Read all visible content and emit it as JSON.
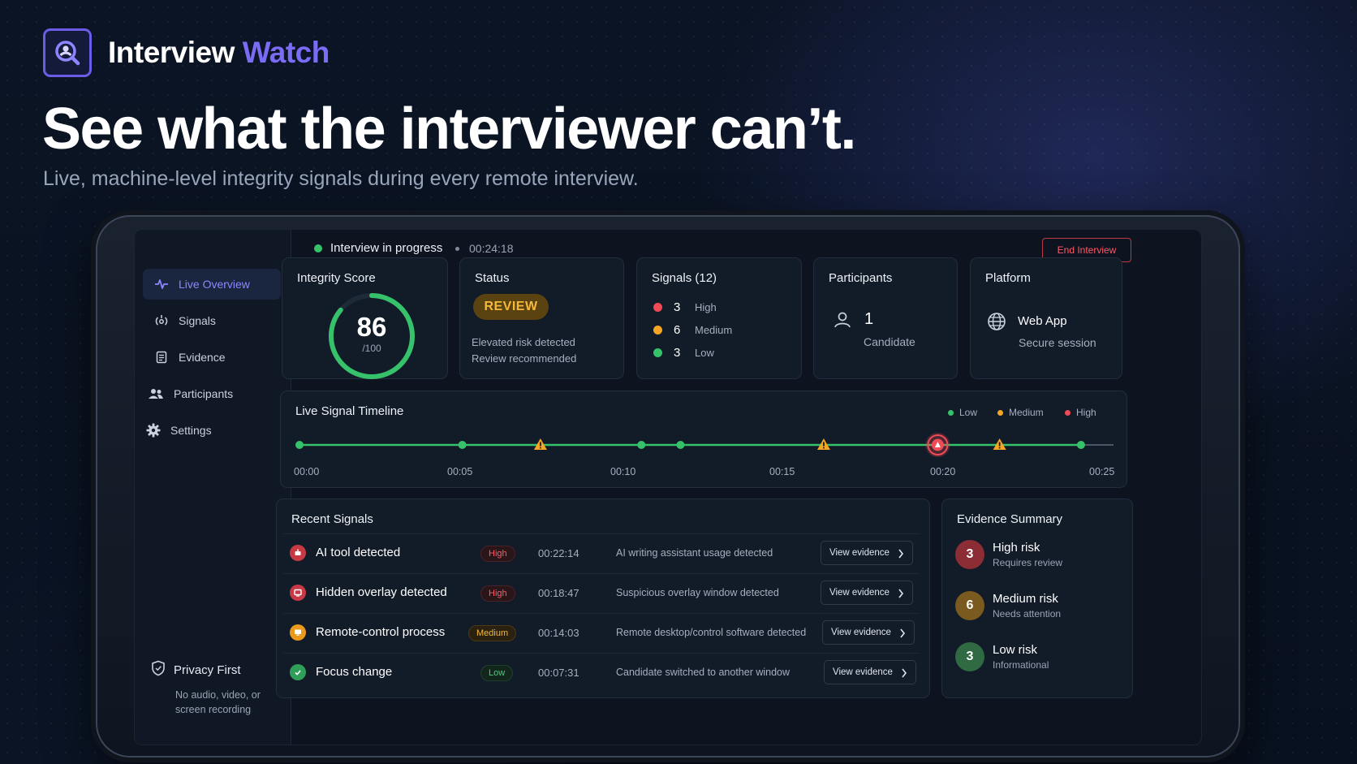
{
  "brand": {
    "name_part1": "Interview",
    "name_part2": "Watch",
    "accent_color": "#7b6cf6"
  },
  "hero": {
    "title": "See what the interviewer can’t.",
    "subtitle": "Live, machine-level integrity signals during every remote interview."
  },
  "sidebar": {
    "items": [
      {
        "label": "Live Overview",
        "icon": "pulse-icon",
        "active": true
      },
      {
        "label": "Signals",
        "icon": "broadcast-icon"
      },
      {
        "label": "Evidence",
        "icon": "document-icon"
      },
      {
        "label": "Participants",
        "icon": "users-icon"
      },
      {
        "label": "Settings",
        "icon": "gear-icon"
      }
    ],
    "privacy": {
      "title": "Privacy First",
      "description": "No audio, video, or screen recording"
    }
  },
  "topbar": {
    "status": "Interview in progress",
    "elapsed": "00:24:18",
    "end_label": "End Interview"
  },
  "integrity": {
    "title": "Integrity Score",
    "score": "86",
    "max": "/100",
    "fraction": 0.86,
    "color": "#36c26a"
  },
  "status": {
    "title": "Status",
    "badge": "REVIEW",
    "line1": "Elevated risk detected",
    "line2": "Review recommended"
  },
  "signals": {
    "title": "Signals (12)",
    "rows": [
      {
        "count": "3",
        "label": "High",
        "color": "#ef4a55"
      },
      {
        "count": "6",
        "label": "Medium",
        "color": "#f5a524"
      },
      {
        "count": "3",
        "label": "Low",
        "color": "#36c26a"
      }
    ]
  },
  "participants": {
    "title": "Participants",
    "count": "1",
    "label": "Candidate"
  },
  "platform": {
    "title": "Platform",
    "name": "Web App",
    "sub": "Secure session"
  },
  "timeline": {
    "title": "Live Signal Timeline",
    "legend": [
      "Low",
      "Medium",
      "High"
    ],
    "ticks": [
      "00:00",
      "00:05",
      "00:10",
      "00:15",
      "00:20",
      "00:25"
    ],
    "events": [
      {
        "t": 0,
        "level": "low"
      },
      {
        "t": 5,
        "level": "low"
      },
      {
        "t": 7.4,
        "level": "medium"
      },
      {
        "t": 10.5,
        "level": "low"
      },
      {
        "t": 11.7,
        "level": "low"
      },
      {
        "t": 16.1,
        "level": "medium"
      },
      {
        "t": 19.6,
        "level": "high"
      },
      {
        "t": 21.5,
        "level": "medium"
      },
      {
        "t": 24,
        "level": "low"
      }
    ]
  },
  "recent": {
    "title": "Recent Signals",
    "button_label": "View evidence",
    "rows": [
      {
        "name": "AI tool detected",
        "level": "High",
        "time": "00:22:14",
        "desc": "AI writing assistant usage detected"
      },
      {
        "name": "Hidden overlay detected",
        "level": "High",
        "time": "00:18:47",
        "desc": "Suspicious overlay window detected"
      },
      {
        "name": "Remote-control process",
        "level": "Medium",
        "time": "00:14:03",
        "desc": "Remote desktop/control software detected"
      },
      {
        "name": "Focus change",
        "level": "Low",
        "time": "00:07:31",
        "desc": "Candidate switched to another window"
      }
    ]
  },
  "evidence": {
    "title": "Evidence Summary",
    "items": [
      {
        "count": "3",
        "title": "High risk",
        "sub": "Requires review",
        "color": "#8c2c35"
      },
      {
        "count": "6",
        "title": "Medium risk",
        "sub": "Needs attention",
        "color": "#7a5a1f"
      },
      {
        "count": "3",
        "title": "Low risk",
        "sub": "Informational",
        "color": "#2f6a43"
      }
    ]
  }
}
